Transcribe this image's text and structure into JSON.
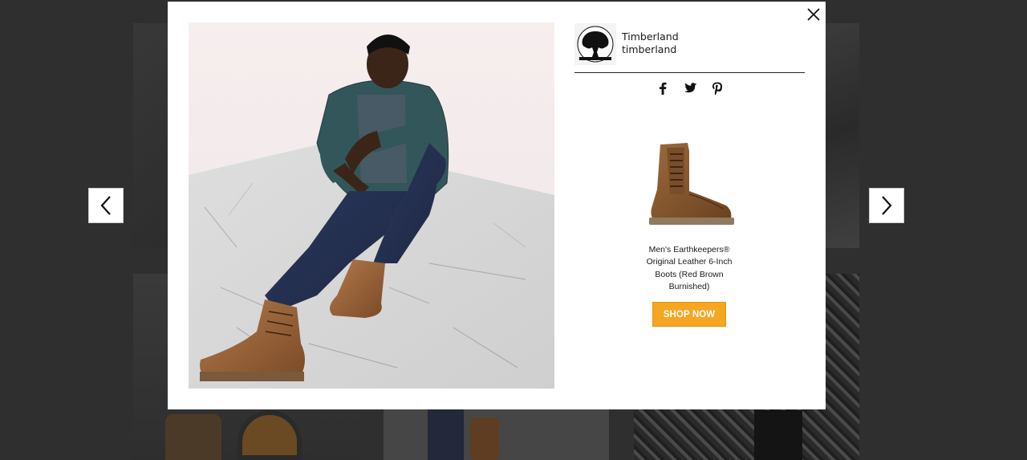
{
  "modal": {
    "brand": {
      "display_name": "Timberland",
      "username": "timberland"
    },
    "share": {
      "facebook_icon": "facebook-icon",
      "twitter_icon": "twitter-icon",
      "pinterest_icon": "pinterest-icon"
    },
    "product": {
      "name": "Men's Earthkeepers® Original Leather 6-Inch Boots (Red Brown Burnished)",
      "cta_label": "SHOP NOW"
    },
    "close_icon": "close-icon"
  },
  "navigation": {
    "prev_icon": "chevron-left-icon",
    "next_icon": "chevron-right-icon"
  },
  "colors": {
    "cta_background": "#f5a623",
    "overlay": "#2f2f2f",
    "modal_background": "#ffffff"
  }
}
